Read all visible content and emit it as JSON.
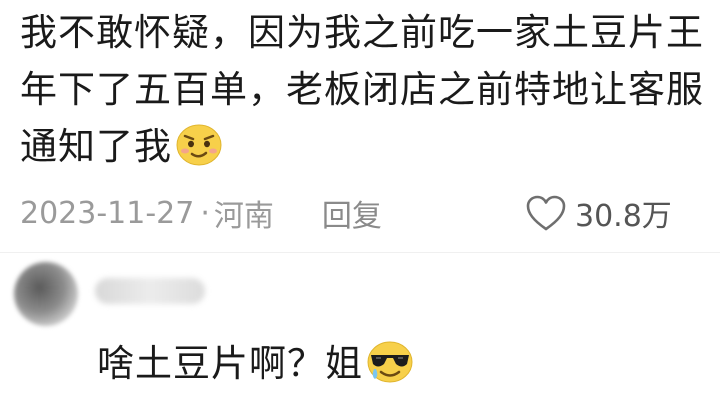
{
  "comment": {
    "lines": [
      "我不敢怀疑，因为我之前吃一家土豆片王",
      "年下了五百单，老板闭店之前特地让客服",
      "通知了我"
    ],
    "emoji_icon": "smirk-face-emoji"
  },
  "meta": {
    "date": "2023-11-27",
    "separator": "·",
    "location": "河南",
    "reply_label": "回复",
    "like_icon": "heart-outline-icon",
    "like_count": "30.8万"
  },
  "reply": {
    "avatar_icon": "blurred-avatar",
    "text": "啥土豆片啊？姐",
    "emoji_icon": "sunglasses-face-emoji"
  }
}
